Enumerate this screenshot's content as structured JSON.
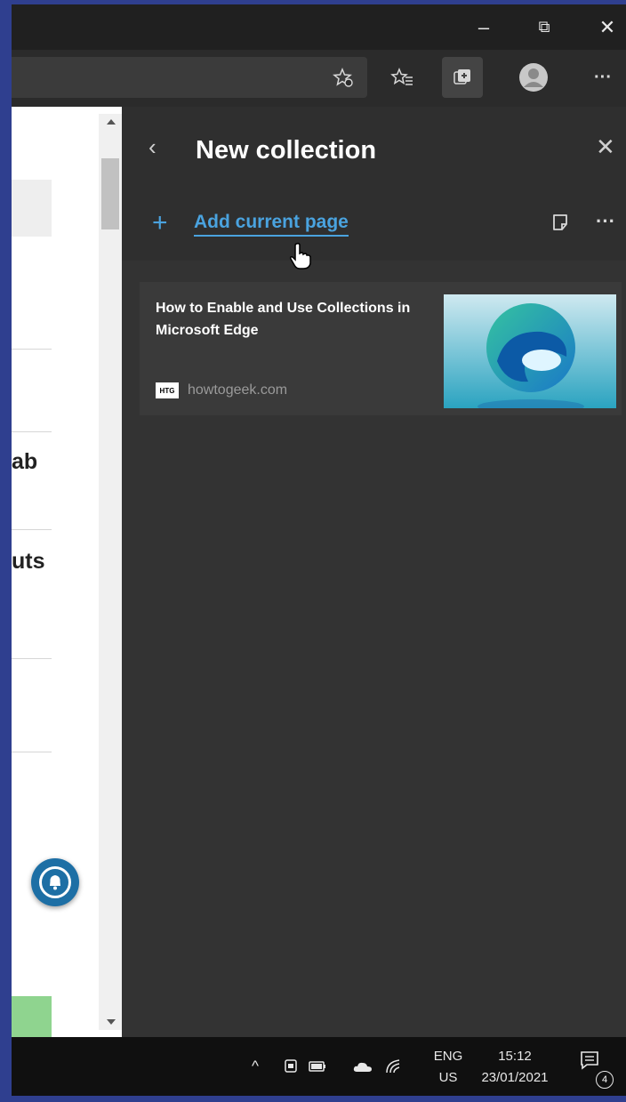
{
  "window": {
    "minimize_label": "–",
    "restore_label": "⧉",
    "close_label": "✕"
  },
  "toolbar": {
    "add_favorite_icon": "star-plus-icon",
    "favorites_icon": "favorites-list-icon",
    "collections_icon": "collections-icon",
    "profile_icon": "profile-avatar-icon",
    "more_label": "···"
  },
  "webpage": {
    "fragments": [
      "ab",
      "uts"
    ],
    "notification_bell_icon": "bell-icon"
  },
  "collections_panel": {
    "back_label": "‹",
    "title": "New collection",
    "close_label": "✕",
    "add_label": "Add current page",
    "more_label": "···",
    "items": [
      {
        "title": "How to Enable and Use Collections in Microsoft Edge",
        "site": "howtogeek.com",
        "favicon_text": "HTG"
      }
    ]
  },
  "taskbar": {
    "chevron": "^",
    "language_top": "ENG",
    "language_bottom": "US",
    "time": "15:12",
    "date": "23/01/2021",
    "notification_count": "4"
  },
  "colors": {
    "accent": "#4aa3df",
    "panel_bg": "#333333",
    "taskbar_bg": "#101010"
  }
}
